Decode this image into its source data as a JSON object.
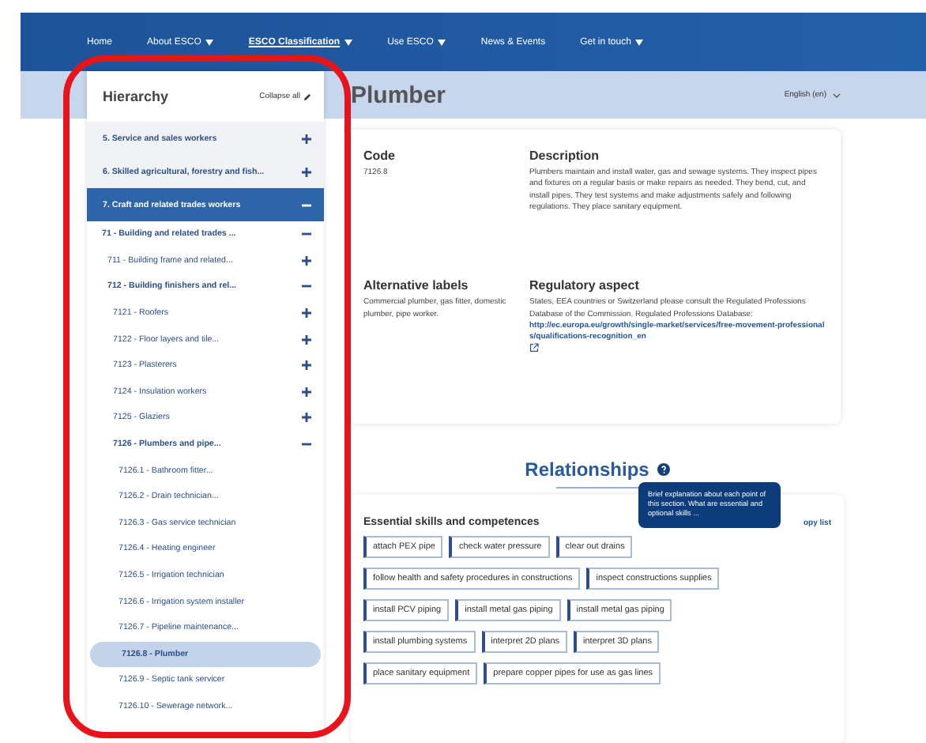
{
  "nav": [
    {
      "label": "Home",
      "selected": false,
      "dropdown": false
    },
    {
      "label": "About ESCO",
      "selected": false,
      "dropdown": true
    },
    {
      "label": "ESCO Classification",
      "selected": true,
      "dropdown": true
    },
    {
      "label": "Use ESCO",
      "selected": false,
      "dropdown": true
    },
    {
      "label": "News & Events",
      "selected": false,
      "dropdown": false
    },
    {
      "label": "Get in touch",
      "selected": false,
      "dropdown": true
    }
  ],
  "sidebar": {
    "title": "Hierarchy",
    "collapse_label": "Collapse all",
    "items": [
      {
        "label": "5. Service and sales workers",
        "expanded": false,
        "selected": false
      },
      {
        "label": "6. Skilled agricultural, forestry and fish...",
        "expanded": false,
        "selected": false
      },
      {
        "label": "7. Craft and related trades workers",
        "expanded": true,
        "selected": true,
        "children": [
          {
            "label": "71 - Building and related trades ...",
            "expanded": true,
            "selected": false,
            "children": [
              {
                "label": "711 - Building frame and related...",
                "expanded": false,
                "selected": false
              },
              {
                "label": "712 - Building finishers and rel...",
                "expanded": true,
                "selected": false,
                "children": [
                  {
                    "label": "7121 - Roofers",
                    "expanded": false,
                    "selected": false
                  },
                  {
                    "label": "7122 - Floor layers and tile...",
                    "expanded": false,
                    "selected": false
                  },
                  {
                    "label": "7123 - Plasterers",
                    "expanded": false,
                    "selected": false
                  },
                  {
                    "label": "7124 - Insulation workers",
                    "expanded": false,
                    "selected": false
                  },
                  {
                    "label": "7125 - Glaziers",
                    "expanded": false,
                    "selected": false
                  },
                  {
                    "label": "7126 - Plumbers and pipe...",
                    "expanded": true,
                    "selected": false,
                    "children": [
                      {
                        "label": "7126.1 - Bathroom fitter...",
                        "selected": false
                      },
                      {
                        "label": "7126.2 - Drain technician...",
                        "selected": false
                      },
                      {
                        "label": "7126.3 - Gas service technician",
                        "selected": false
                      },
                      {
                        "label": "7126.4 - Heating engineer",
                        "selected": false
                      },
                      {
                        "label": "7126.5 - Irrigation technician",
                        "selected": false
                      },
                      {
                        "label": "7126.6 - Irrigation system installer",
                        "selected": false
                      },
                      {
                        "label": "7126.7 - Pipeline maintenance...",
                        "selected": false
                      },
                      {
                        "label": "7126.8 - Plumber",
                        "selected": true
                      },
                      {
                        "label": "7126.9 - Septic tank servicer",
                        "selected": false
                      },
                      {
                        "label": "7126.10 - Sewerage network...",
                        "selected": false
                      }
                    ]
                  }
                ]
              }
            ]
          }
        ]
      }
    ]
  },
  "page": {
    "title": "Plumber",
    "language": "English (en)"
  },
  "details": {
    "code_heading": "Code",
    "code": "7126.8",
    "description_heading": "Description",
    "description": "Plumbers maintain and install water, gas and sewage systems. They inspect pipes and fixtures on a regular basis or make repairs as needed. They bend, cut, and install pipes. They test systems and make adjustments safely and following regulations. They place sanitary equipment.",
    "alt_heading": "Alternative labels",
    "alt_labels": "Commercial plumber, gas fitter, domestic plumber, pipe worker.",
    "regulatory_heading": "Regulatory aspect",
    "regulatory_text": "States, EEA countries or Switzerland please consult the Regulated Professions Database of the Commission. Regulated Professions Database:",
    "regulatory_link": "http://ec.europa.eu/growth/single-market/services/free-movement-professionals/qualifications-recognition_en"
  },
  "relationships": {
    "title": "Relationships",
    "tooltip": "Brief explanation about each point of this section. What are essential and optional skills ...",
    "skills_heading": "Essential skills and competences",
    "copy_label": "opy list",
    "skills": [
      "attach PEX pipe",
      "check water pressure",
      "clear out drains",
      "follow health and safety procedures in constructions",
      "inspect constructions supplies",
      "install PCV piping",
      "install metal gas piping",
      "install metal gas piping",
      "install plumbing systems",
      "interpret 2D plans",
      "interpret 3D plans",
      "place sanitary equipment",
      "prepare copper pipes for use as gas lines"
    ]
  }
}
